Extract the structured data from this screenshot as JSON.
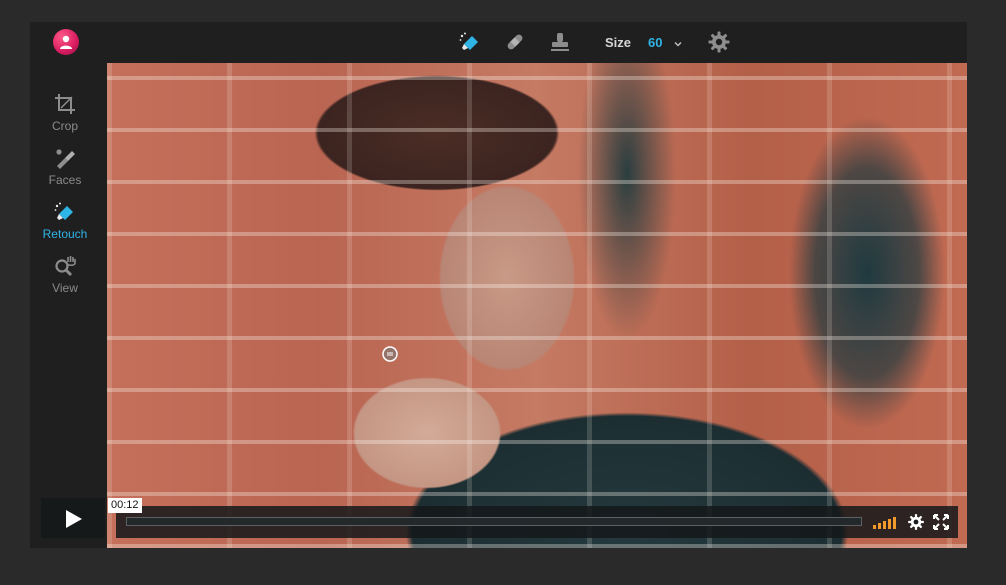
{
  "toolbar": {
    "size_label": "Size",
    "size_value": "60",
    "tools": [
      "retouch-brush-icon",
      "bandage-icon",
      "clone-stamp-icon"
    ]
  },
  "sidebar": {
    "items": [
      {
        "label": "Crop",
        "icon": "crop-icon",
        "active": false
      },
      {
        "label": "Faces",
        "icon": "faces-icon",
        "active": false
      },
      {
        "label": "Retouch",
        "icon": "retouch-icon",
        "active": true
      },
      {
        "label": "View",
        "icon": "view-icon",
        "active": false
      }
    ]
  },
  "player": {
    "time": "00:12",
    "volume_level": 1.0
  },
  "colors": {
    "accent": "#2fb4e6",
    "volume": "#f39a2c",
    "logo": "#d81b60"
  }
}
